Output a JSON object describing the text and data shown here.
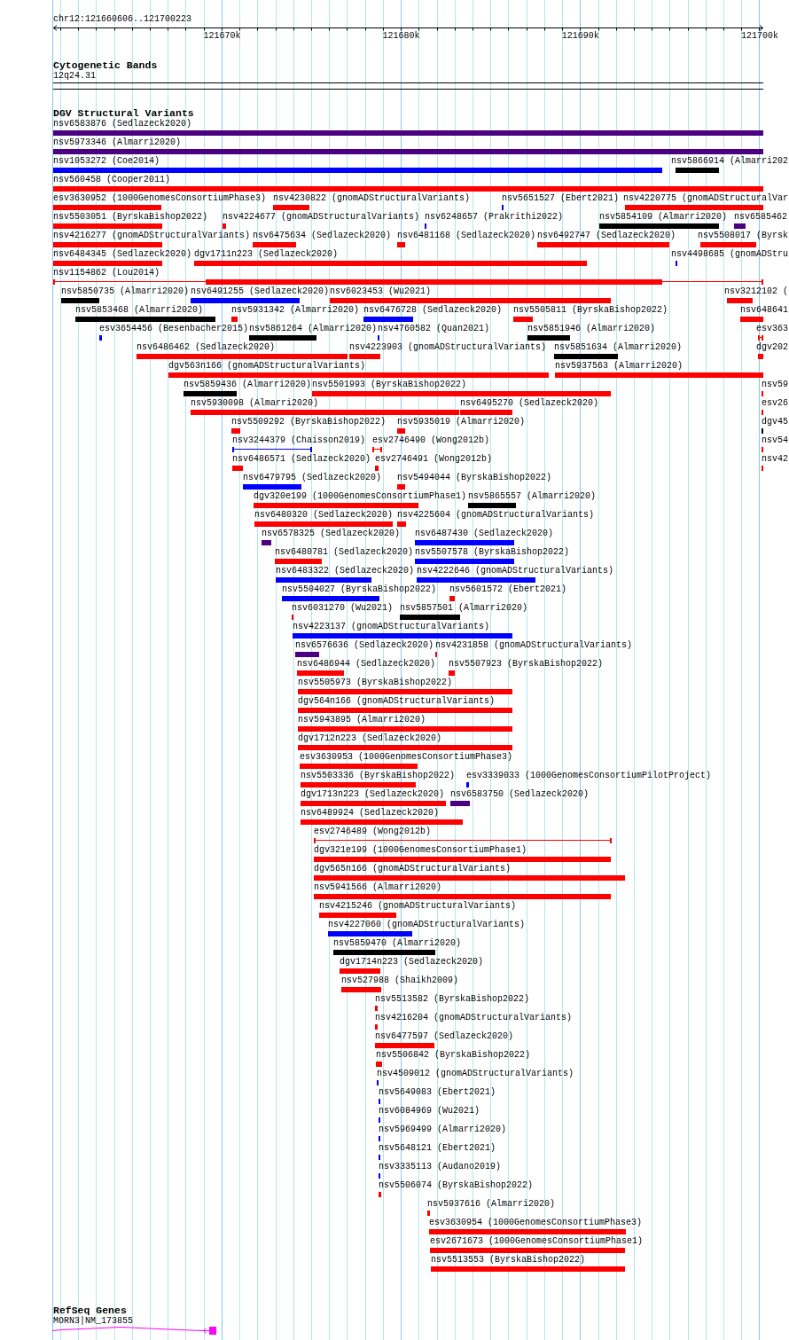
{
  "ruler": {
    "location": "chr12:121660606..121700223",
    "ticks": [
      "121670k",
      "121680k",
      "121690k",
      "121700k"
    ]
  },
  "cytogenetic_bands": {
    "title": "Cytogenetic Bands",
    "band": "12q24.31"
  },
  "dgv_structural_variants": {
    "title": "DGV Structural Variants",
    "rows": [
      [
        {
          "label": "nsv6583876 (Sedlazeck2020)",
          "color": "#4b0082",
          "kind": "bar"
        }
      ],
      [
        {
          "label": "nsv5973346 (Almarri2020)",
          "color": "#4b0082",
          "kind": "bar"
        }
      ],
      [
        {
          "label": "nsv1053272 (Coe2014)",
          "color": "#0000ff",
          "kind": "bar"
        },
        {
          "label": "nsv5866914 (Almarri202",
          "color": "#000000",
          "kind": "bar"
        }
      ],
      [
        {
          "label": "nsv560458 (Cooper2011)",
          "color": "#ff0000",
          "kind": "bar"
        }
      ],
      [
        {
          "label": "esv3630952 (1000GenomesConsortiumPhase3)",
          "color": "#ff0000",
          "kind": "bar"
        },
        {
          "label": "nsv4230822 (gnomADStructuralVariants)",
          "color": "#ff0000",
          "kind": "bar"
        },
        {
          "label": "nsv5651527 (Ebert2021)",
          "color": "#0000ff",
          "kind": "bar"
        },
        {
          "label": "nsv4220775 (gnomADStructuralVar",
          "color": "#ff0000",
          "kind": "bar"
        }
      ],
      [
        {
          "label": "nsv5503051 (ByrskaBishop2022)",
          "color": "#ff0000",
          "kind": "bar"
        },
        {
          "label": "nsv4224677 (gnomADStructuralVariants)",
          "color": "#ff0000",
          "kind": "bar"
        },
        {
          "label": "nsv6248657 (Prakrithi2022)",
          "color": "#0000ff",
          "kind": "bar"
        },
        {
          "label": "nsv5854109 (Almarri2020)",
          "color": "#000000",
          "kind": "bar"
        },
        {
          "label": "nsv6585462",
          "color": "#4b0082",
          "kind": "bar"
        }
      ],
      [
        {
          "label": "nsv4216277 (gnomADStructuralVariants)",
          "color": "#ff0000",
          "kind": "bar"
        },
        {
          "label": "nsv6475634 (Sedlazeck2020)",
          "color": "#ff0000",
          "kind": "bar"
        },
        {
          "label": "nsv6481168 (Sedlazeck2020)",
          "color": "#ff0000",
          "kind": "bar"
        },
        {
          "label": "nsv6492747 (Sedlazeck2020)",
          "color": "#ff0000",
          "kind": "bar"
        },
        {
          "label": "nsv5508017 (Byrsk",
          "color": "#ff0000",
          "kind": "bar"
        }
      ],
      [
        {
          "label": "nsv6484345 (Sedlazeck2020)",
          "color": "#ff0000",
          "kind": "bar"
        },
        {
          "label": "dgv1711n223 (Sedlazeck2020)",
          "color": "#ff0000",
          "kind": "bar"
        },
        {
          "label": "nsv4498685 (gnomADStru",
          "color": "#0000ff",
          "kind": "bar"
        }
      ],
      [
        {
          "label": "nsv1154862 (Lou2014)",
          "color": "#ff0000",
          "kind": "cored"
        }
      ],
      [
        {
          "label": "nsv5850735 (Almarri2020)",
          "color": "#000000",
          "kind": "bar"
        },
        {
          "label": "nsv6491255 (Sedlazeck2020)",
          "color": "#0000ff",
          "kind": "bar"
        },
        {
          "label": "nsv6023453 (Wu2021)",
          "color": "#ff0000",
          "kind": "bar"
        },
        {
          "label": "nsv3212102 (",
          "color": "#ff0000",
          "kind": "bar"
        }
      ],
      [
        {
          "label": "nsv5853468 (Almarri2020)",
          "color": "#000000",
          "kind": "bar"
        },
        {
          "label": "nsv5931342 (Almarri2020)",
          "color": "#ff0000",
          "kind": "bar"
        },
        {
          "label": "nsv6476728 (Sedlazeck2020)",
          "color": "#0000ff",
          "kind": "bar"
        },
        {
          "label": "nsv5505811 (ByrskaBishop2022)",
          "color": "#ff0000",
          "kind": "bar"
        },
        {
          "label": "nsv648641",
          "color": "#ff0000",
          "kind": "bar"
        }
      ],
      [
        {
          "label": "esv3654456 (Besenbacher2015)",
          "color": "#0000ff",
          "kind": "bar"
        },
        {
          "label": "nsv5861264 (Almarri2020)",
          "color": "#000000",
          "kind": "bar"
        },
        {
          "label": "nsv4760582 (Quan2021)",
          "color": "#0000ff",
          "kind": "bar"
        },
        {
          "label": "nsv5851946 (Almarri2020)",
          "color": "#000000",
          "kind": "bar"
        },
        {
          "label": "esv363",
          "color": "#ff0000",
          "kind": "span"
        }
      ],
      [
        {
          "label": "nsv6486462 (Sedlazeck2020)",
          "color": "#ff0000",
          "kind": "bar"
        },
        {
          "label": "nsv4223903 (gnomADStructuralVariants)",
          "color": "#ff0000",
          "kind": "bar"
        },
        {
          "label": "nsv5851634 (Almarri2020)",
          "color": "#000000",
          "kind": "bar"
        },
        {
          "label": "dgv202",
          "color": "#ff0000",
          "kind": "bar"
        }
      ],
      [
        {
          "label": "dgv563n166 (gnomADStructuralVariants)",
          "color": "#ff0000",
          "kind": "bar"
        },
        {
          "label": "nsv5937563 (Almarri2020)",
          "color": "#ff0000",
          "kind": "bar"
        }
      ],
      [
        {
          "label": "nsv5859436 (Almarri2020)",
          "color": "#000000",
          "kind": "bar"
        },
        {
          "label": "nsv5501993 (ByrskaBishop2022)",
          "color": "#ff0000",
          "kind": "bar"
        },
        {
          "label": "nsv59",
          "color": "#ff0000",
          "kind": "bar"
        }
      ],
      [
        {
          "label": "nsv5930098 (Almarri2020)",
          "color": "#ff0000",
          "kind": "bar"
        },
        {
          "label": "nsv6495270 (Sedlazeck2020)",
          "color": "#ff0000",
          "kind": "bar"
        },
        {
          "label": "esv26",
          "color": "#ff0000",
          "kind": "bar"
        }
      ],
      [
        {
          "label": "nsv5509292 (ByrskaBishop2022)",
          "color": "#ff0000",
          "kind": "bar"
        },
        {
          "label": "nsv5935019 (Almarri2020)",
          "color": "#ff0000",
          "kind": "bar"
        },
        {
          "label": "dgv45",
          "color": "#000000",
          "kind": "bar"
        }
      ],
      [
        {
          "label": "nsv3244379 (Chaisson2019)",
          "color": "#0000ff",
          "kind": "span"
        },
        {
          "label": "esv2746490 (Wong2012b)",
          "color": "#ff0000",
          "kind": "span"
        },
        {
          "label": "nsv54",
          "color": "#ff0000",
          "kind": "bar"
        }
      ],
      [
        {
          "label": "nsv6486571 (Sedlazeck2020)",
          "color": "#ff0000",
          "kind": "bar"
        },
        {
          "label": "esv2746491 (Wong2012b)",
          "color": "#ff0000",
          "kind": "span"
        },
        {
          "label": "nsv42",
          "color": "#ff0000",
          "kind": "bar"
        }
      ],
      [
        {
          "label": "nsv6479795 (Sedlazeck2020)",
          "color": "#0000ff",
          "kind": "bar"
        },
        {
          "label": "nsv5494044 (ByrskaBishop2022)",
          "color": "#ff0000",
          "kind": "bar"
        }
      ],
      [
        {
          "label": "dgv320e199 (1000GenomesConsortiumPhase1)",
          "color": "#ff0000",
          "kind": "bar"
        },
        {
          "label": "nsv5865557 (Almarri2020)",
          "color": "#000000",
          "kind": "bar"
        }
      ],
      [
        {
          "label": "nsv6480320 (Sedlazeck2020)",
          "color": "#ff0000",
          "kind": "bar"
        },
        {
          "label": "nsv4225604 (gnomADStructuralVariants)",
          "color": "#ff0000",
          "kind": "bar"
        }
      ],
      [
        {
          "label": "nsv6578325 (Sedlazeck2020)",
          "color": "#4b0082",
          "kind": "bar"
        },
        {
          "label": "nsv6487430 (Sedlazeck2020)",
          "color": "#0000ff",
          "kind": "bar"
        }
      ],
      [
        {
          "label": "nsv6480781 (Sedlazeck2020)",
          "color": "#ff0000",
          "kind": "bar"
        },
        {
          "label": "nsv5507578 (ByrskaBishop2022)",
          "color": "#0000ff",
          "kind": "bar"
        }
      ],
      [
        {
          "label": "nsv6483322 (Sedlazeck2020)",
          "color": "#0000ff",
          "kind": "bar"
        },
        {
          "label": "nsv4222646 (gnomADStructuralVariants)",
          "color": "#0000ff",
          "kind": "bar"
        }
      ],
      [
        {
          "label": "nsv5504027 (ByrskaBishop2022)",
          "color": "#0000ff",
          "kind": "bar"
        },
        {
          "label": "nsv5601572 (Ebert2021)",
          "color": "#ff0000",
          "kind": "bar"
        }
      ],
      [
        {
          "label": "nsv6031270 (Wu2021)",
          "color": "#ff0000",
          "kind": "bar"
        },
        {
          "label": "nsv5857501 (Almarri2020)",
          "color": "#000000",
          "kind": "bar"
        }
      ],
      [
        {
          "label": "nsv4223137 (gnomADStructuralVariants)",
          "color": "#0000ff",
          "kind": "bar"
        }
      ],
      [
        {
          "label": "nsv6576636 (Sedlazeck2020)",
          "color": "#4b0082",
          "kind": "bar"
        },
        {
          "label": "nsv4231858 (gnomADStructuralVariants)",
          "color": "#ff0000",
          "kind": "bar"
        }
      ],
      [
        {
          "label": "nsv6486944 (Sedlazeck2020)",
          "color": "#ff0000",
          "kind": "bar"
        },
        {
          "label": "nsv5507923 (ByrskaBishop2022)",
          "color": "#ff0000",
          "kind": "bar"
        }
      ],
      [
        {
          "label": "nsv5505973 (ByrskaBishop2022)",
          "color": "#ff0000",
          "kind": "bar"
        }
      ],
      [
        {
          "label": "dgv564n166 (gnomADStructuralVariants)",
          "color": "#ff0000",
          "kind": "bar"
        }
      ],
      [
        {
          "label": "nsv5943895 (Almarri2020)",
          "color": "#ff0000",
          "kind": "bar"
        }
      ],
      [
        {
          "label": "dgv1712n223 (Sedlazeck2020)",
          "color": "#ff0000",
          "kind": "bar"
        }
      ],
      [
        {
          "label": "esv3630953 (1000GenomesConsortiumPhase3)",
          "color": "#ff0000",
          "kind": "bar"
        }
      ],
      [
        {
          "label": "nsv5503336 (ByrskaBishop2022)",
          "color": "#ff0000",
          "kind": "bar"
        },
        {
          "label": "esv3339033 (1000GenomesConsortiumPilotProject)",
          "color": "#0000ff",
          "kind": "bar"
        }
      ],
      [
        {
          "label": "dgv1713n223 (Sedlazeck2020)",
          "color": "#ff0000",
          "kind": "bar"
        },
        {
          "label": "nsv6583750 (Sedlazeck2020)",
          "color": "#4b0082",
          "kind": "bar"
        }
      ],
      [
        {
          "label": "nsv6489924 (Sedlazeck2020)",
          "color": "#ff0000",
          "kind": "bar"
        }
      ],
      [
        {
          "label": "esv2746489 (Wong2012b)",
          "color": "#ff0000",
          "kind": "span"
        }
      ],
      [
        {
          "label": "dgv321e199 (1000GenomesConsortiumPhase1)",
          "color": "#ff0000",
          "kind": "bar"
        }
      ],
      [
        {
          "label": "dgv565n166 (gnomADStructuralVariants)",
          "color": "#ff0000",
          "kind": "bar"
        }
      ],
      [
        {
          "label": "nsv5941566 (Almarri2020)",
          "color": "#ff0000",
          "kind": "bar"
        }
      ],
      [
        {
          "label": "nsv4215246 (gnomADStructuralVariants)",
          "color": "#ff0000",
          "kind": "bar"
        }
      ],
      [
        {
          "label": "nsv4227060 (gnomADStructuralVariants)",
          "color": "#0000ff",
          "kind": "bar"
        }
      ],
      [
        {
          "label": "nsv5859470 (Almarri2020)",
          "color": "#000000",
          "kind": "bar"
        }
      ],
      [
        {
          "label": "dgv1714n223 (Sedlazeck2020)",
          "color": "#ff0000",
          "kind": "bar"
        }
      ],
      [
        {
          "label": "nsv527988 (Shaikh2009)",
          "color": "#ff0000",
          "kind": "bar"
        }
      ],
      [
        {
          "label": "nsv5513582 (ByrskaBishop2022)",
          "color": "#ff0000",
          "kind": "bar"
        }
      ],
      [
        {
          "label": "nsv4216204 (gnomADStructuralVariants)",
          "color": "#ff0000",
          "kind": "bar"
        }
      ],
      [
        {
          "label": "nsv6477597 (Sedlazeck2020)",
          "color": "#ff0000",
          "kind": "bar"
        }
      ],
      [
        {
          "label": "nsv5506842 (ByrskaBishop2022)",
          "color": "#ff0000",
          "kind": "bar"
        }
      ],
      [
        {
          "label": "nsv4509012 (gnomADStructuralVariants)",
          "color": "#0000ff",
          "kind": "bar"
        }
      ],
      [
        {
          "label": "nsv5649083 (Ebert2021)",
          "color": "#0000ff",
          "kind": "bar"
        }
      ],
      [
        {
          "label": "nsv6084969 (Wu2021)",
          "color": "#0000ff",
          "kind": "bar"
        }
      ],
      [
        {
          "label": "nsv5969499 (Almarri2020)",
          "color": "#0000ff",
          "kind": "bar"
        }
      ],
      [
        {
          "label": "nsv5648121 (Ebert2021)",
          "color": "#0000ff",
          "kind": "bar"
        }
      ],
      [
        {
          "label": "nsv3335113 (Audano2019)",
          "color": "#0000ff",
          "kind": "bar"
        }
      ],
      [
        {
          "label": "nsv5506074 (ByrskaBishop2022)",
          "color": "#ff0000",
          "kind": "bar"
        }
      ],
      [
        {
          "label": "nsv5937616 (Almarri2020)",
          "color": "#ff0000",
          "kind": "bar"
        }
      ],
      [
        {
          "label": "esv3630954 (1000GenomesConsortiumPhase3)",
          "color": "#ff0000",
          "kind": "bar"
        }
      ],
      [
        {
          "label": "esv2671673 (1000GenomesConsortiumPhase1)",
          "color": "#ff0000",
          "kind": "bar"
        }
      ],
      [
        {
          "label": "nsv5513553 (ByrskaBishop2022)",
          "color": "#ff0000",
          "kind": "bar"
        }
      ]
    ]
  },
  "refseq_genes": {
    "title": "RefSeq Genes",
    "genes": [
      {
        "label": "MORN3|NM_173855"
      }
    ]
  }
}
